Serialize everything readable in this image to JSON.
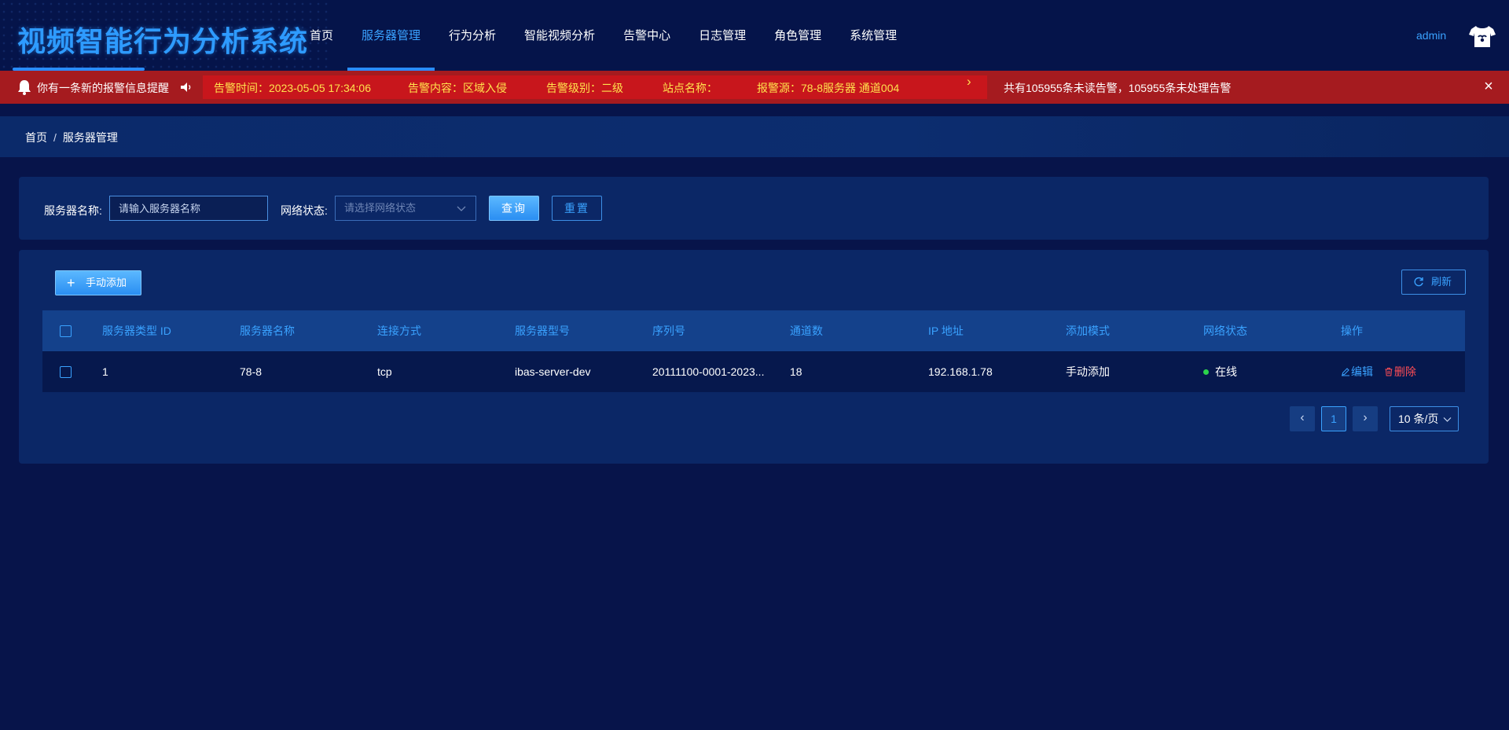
{
  "header": {
    "app_title": "视频智能行为分析系统",
    "nav": [
      {
        "label": "首页",
        "active": false
      },
      {
        "label": "服务器管理",
        "active": true
      },
      {
        "label": "行为分析",
        "active": false
      },
      {
        "label": "智能视频分析",
        "active": false
      },
      {
        "label": "告警中心",
        "active": false
      },
      {
        "label": "日志管理",
        "active": false
      },
      {
        "label": "角色管理",
        "active": false
      },
      {
        "label": "系统管理",
        "active": false
      }
    ],
    "user": "admin",
    "user_icon": "shirt-icon"
  },
  "alert": {
    "message": "你有一条新的报警信息提醒",
    "time": "告警时间：2023-05-05 17:34:06",
    "content": "告警内容：区域入侵",
    "level": "告警级别：二级",
    "site": "站点名称：",
    "source": "报警源：78-8服务器 通道004",
    "summary": "共有105955条未读告警，105955条未处理告警",
    "close": "×",
    "next": "›"
  },
  "breadcrumb": {
    "home": "首页",
    "separator": "/",
    "current": "服务器管理"
  },
  "search": {
    "name_label": "服务器名称:",
    "name_placeholder": "请输入服务器名称",
    "status_label": "网络状态:",
    "status_placeholder": "请选择网络状态",
    "query_label": "查询",
    "reset_label": "重置"
  },
  "toolbar": {
    "add_label": "手动添加",
    "refresh_label": "刷新"
  },
  "table": {
    "headers": {
      "type_id": "服务器类型 ID",
      "name": "服务器名称",
      "connection": "连接方式",
      "model": "服务器型号",
      "serial": "序列号",
      "channels": "通道数",
      "ip": "IP 地址",
      "add_mode": "添加模式",
      "network": "网络状态",
      "actions": "操作"
    },
    "rows": [
      {
        "type_id": "1",
        "name": "78-8",
        "connection": "tcp",
        "model": "ibas-server-dev",
        "serial": "20111100-0001-2023...",
        "channels": "18",
        "ip": "192.168.1.78",
        "add_mode": "手动添加",
        "network": "在线",
        "edit": "编辑",
        "delete": "删除"
      }
    ]
  },
  "pagination": {
    "current_page": "1",
    "page_size": "10 条/页"
  },
  "colors": {
    "background": "#07144a",
    "accent": "#3aa2ff",
    "alert_red": "#a51b1f",
    "alert_text": "#ffe24d",
    "online_green": "#2bd44b",
    "delete_red": "#ff4d55"
  }
}
